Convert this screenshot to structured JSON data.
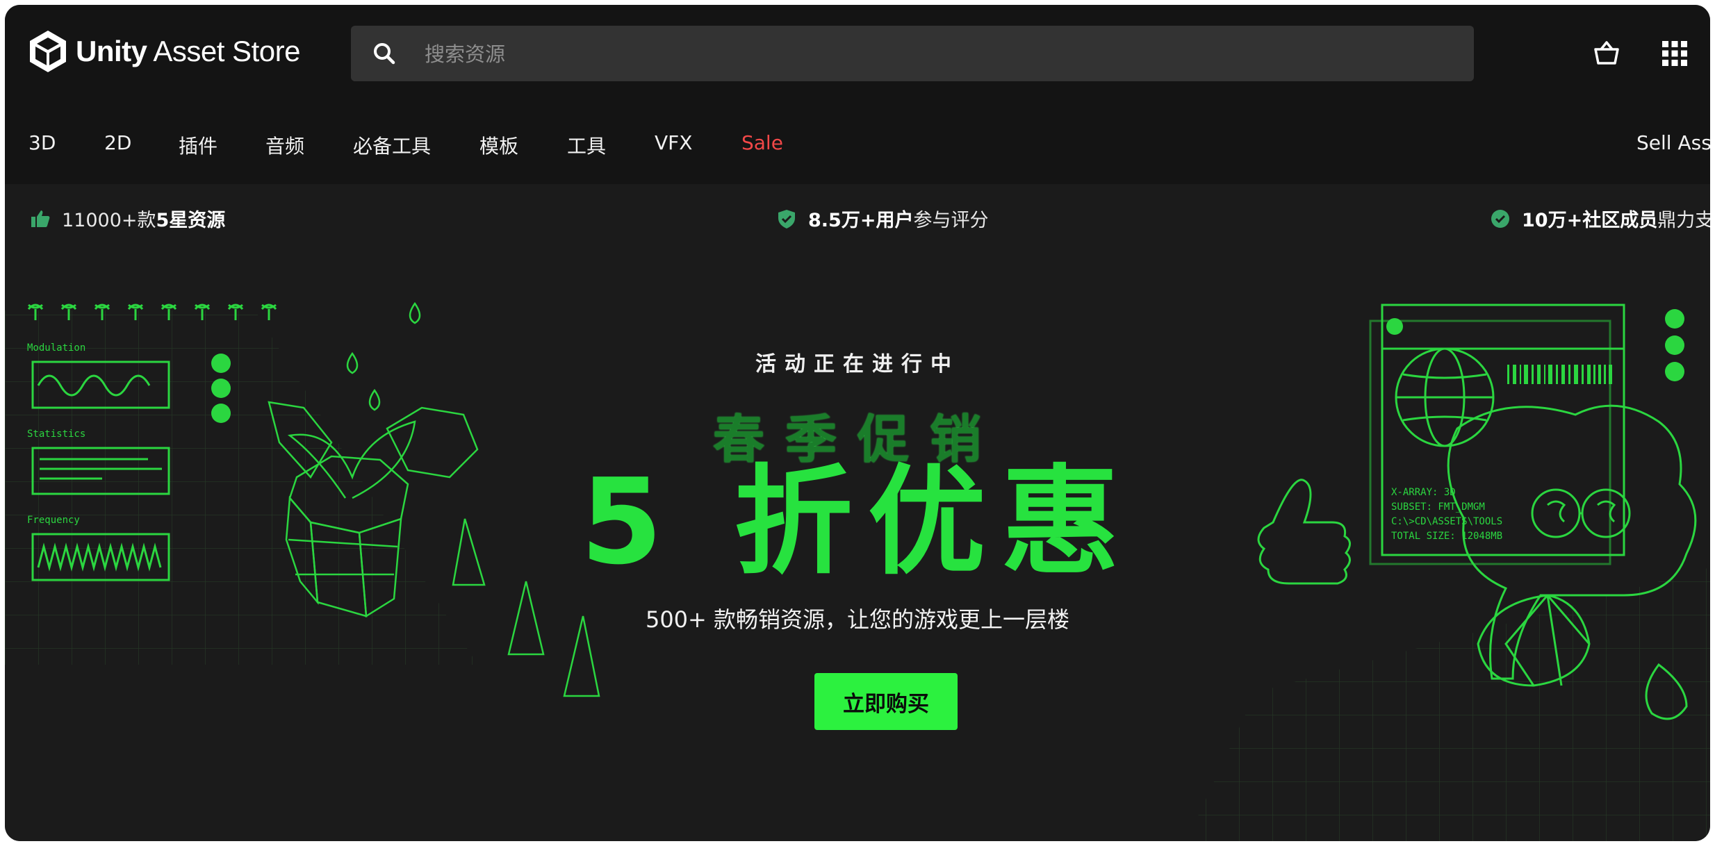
{
  "header": {
    "logo_bold": "Unity",
    "logo_rest": " Asset Store",
    "search_placeholder": "搜索资源"
  },
  "nav": {
    "items": [
      "3D",
      "2D",
      "插件",
      "音频",
      "必备工具",
      "模板",
      "工具",
      "VFX",
      "Sale"
    ],
    "sell_label": "Sell Ass"
  },
  "trust": [
    {
      "pre": "11000+款",
      "bold": "5星资源",
      "post": ""
    },
    {
      "pre": "",
      "bold": "8.5万+用户",
      "post": "参与评分"
    },
    {
      "pre": "",
      "bold": "10万+社区成员",
      "post": "鼎力支"
    }
  ],
  "hero": {
    "eyebrow": "活动正在进行中",
    "headline": "春季促销",
    "bigline": "5 折优惠",
    "subline": "500+ 款畅销资源，让您的游戏更上一层楼",
    "cta": "立即购买",
    "panel_labels": [
      "Modulation",
      "Statistics",
      "Frequency"
    ],
    "terminal_lines": [
      "X-ARRAY: 3D",
      "SUBSET: FMT_DMGM",
      "C:\\>CD\\ASSETS\\TOOLS",
      "TOTAL SIZE: 12048MB"
    ]
  },
  "colors": {
    "accent_green": "#2cf13f",
    "sale_red": "#f24848",
    "background": "#1b1b1b",
    "trust_icon_green": "#3aa66a"
  },
  "icons": {
    "logo": "unity-cube-icon",
    "search": "search-icon",
    "cart": "basket-icon",
    "apps": "grid-icon",
    "trust1": "thumbs-up-icon",
    "trust2": "shield-check-icon",
    "trust3": "check-circle-icon"
  }
}
